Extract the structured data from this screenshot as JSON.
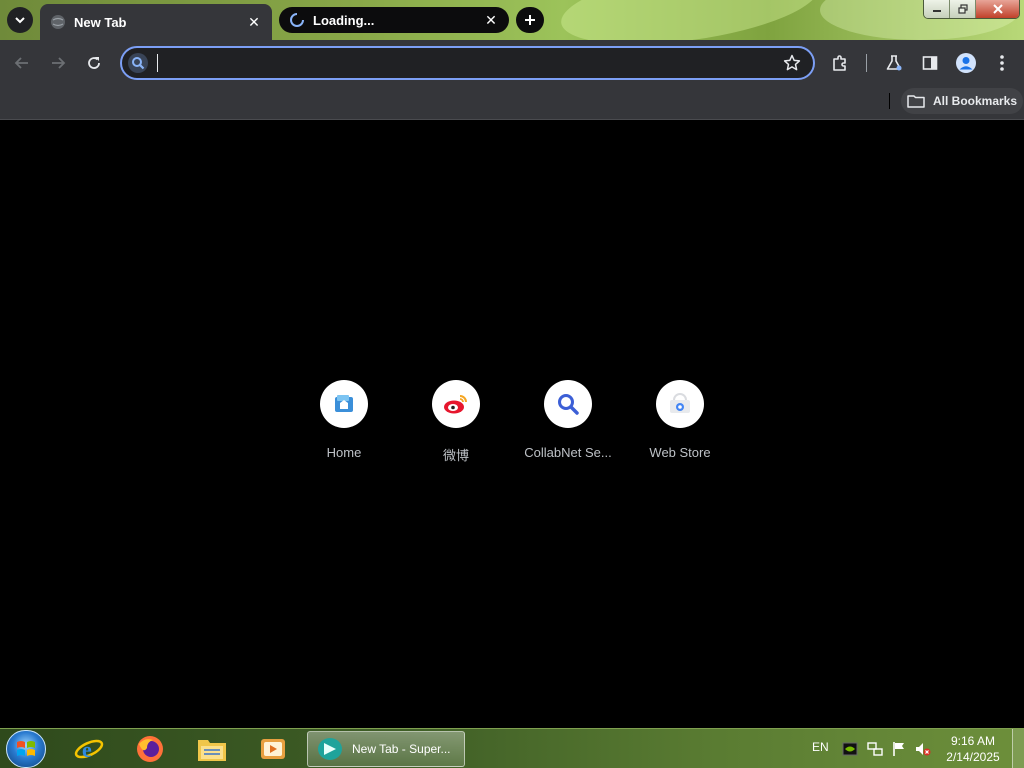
{
  "browser": {
    "tabs": [
      {
        "title": "New Tab",
        "active": true
      },
      {
        "title": "Loading...",
        "active": false
      }
    ],
    "omnibox": {
      "value": "",
      "placeholder": ""
    },
    "bookmarks_bar": {
      "all_bookmarks_label": "All Bookmarks"
    },
    "accent_color": "#7c9ff5"
  },
  "shortcuts": [
    {
      "label": "Home",
      "icon": "home-folder-icon"
    },
    {
      "label": "微博",
      "icon": "weibo-icon"
    },
    {
      "label": "CollabNet Se...",
      "icon": "collabnet-search-icon"
    },
    {
      "label": "Web Store",
      "icon": "web-store-icon"
    }
  ],
  "taskbar": {
    "window_item": "New Tab - Super...",
    "language": "EN",
    "time": "9:16 AM",
    "date": "2/14/2025"
  }
}
